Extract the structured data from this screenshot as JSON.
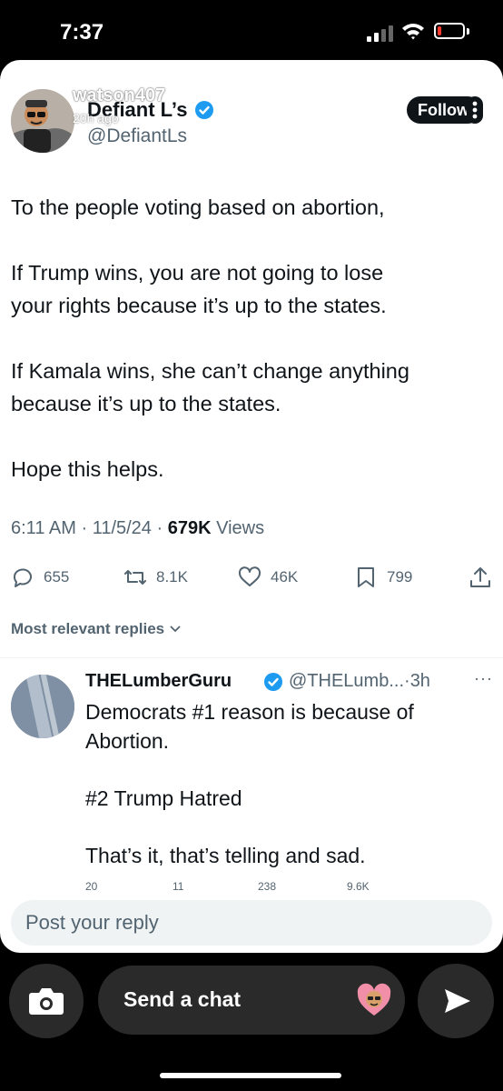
{
  "status_bar": {
    "time": "7:37"
  },
  "post": {
    "watermark_user": "watson407",
    "watermark_age": "20h ago",
    "display_name": "Defiant L’s",
    "handle": "@DefiantLs",
    "follow_label": "Follow",
    "paragraphs": [
      "To the people voting based on abortion,",
      "If Trump wins, you are not going to lose\nyour rights because it’s up to the states.",
      "If Kamala wins, she can’t change anything\nbecause it’s up to the states.",
      "Hope this helps."
    ],
    "time": "6:11 AM",
    "date": "11/5/24",
    "views_count": "679K",
    "views_label": "Views",
    "replies": "655",
    "reposts": "8.1K",
    "likes": "46K",
    "bookmarks": "799"
  },
  "replies_sort_label": "Most relevant replies",
  "reply": {
    "name": "THELumberGuru",
    "handle": "@THELumb...",
    "separator": "·",
    "age": "3h",
    "more": "···",
    "paragraphs": [
      "Democrats #1 reason is because of Abortion.",
      "#2 Trump Hatred",
      "That’s it, that’s telling and sad."
    ],
    "stats": [
      "20",
      "11",
      "238",
      "9.6K"
    ]
  },
  "composer": {
    "placeholder": "Post your reply"
  },
  "chat": {
    "placeholder": "Send a chat"
  },
  "colors": {
    "verified": "#1d9bf0",
    "text": "#0f1419",
    "muted": "#536471",
    "chat_bar": "#2a2a2a",
    "battery": "#ff3b30"
  },
  "status": {
    "battery_level_percent": 15
  }
}
